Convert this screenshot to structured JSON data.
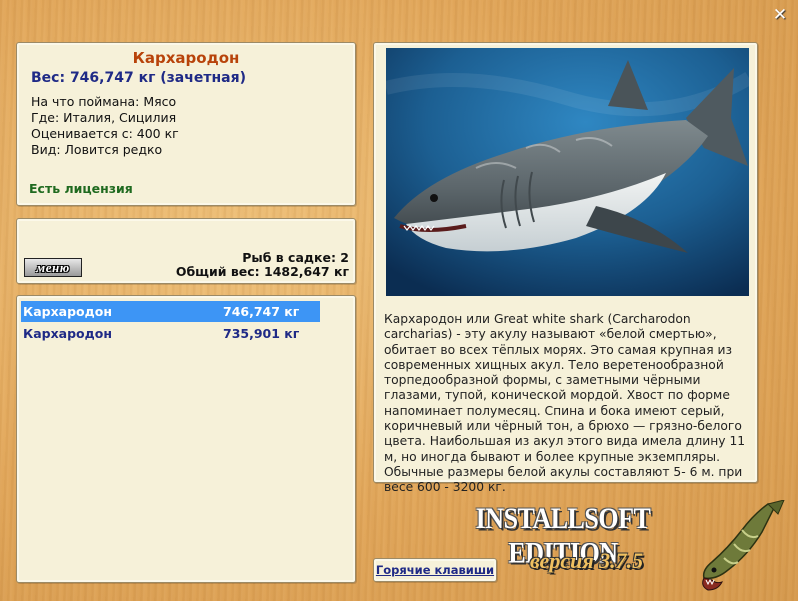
{
  "window": {
    "close_glyph": "✕"
  },
  "fish": {
    "name": "Кархародон",
    "weight_line": "Вес: 746,747 кг (зачетная)",
    "caught_on": "На что поймана: Мясо",
    "where": "Где: Италия, Сицилия",
    "rated_from": "Оценивается с: 400 кг",
    "kind": "Вид: Ловится редко",
    "license": "Есть лицензия"
  },
  "keep": {
    "menu_label": "меню",
    "count_line": "Рыб в садке: 2",
    "total_line": "Общий вес: 1482,647 кг"
  },
  "catch_list": [
    {
      "name": "Кархародон",
      "weight": "746,747 кг",
      "selected": true
    },
    {
      "name": "Кархародон",
      "weight": "735,901 кг",
      "selected": false
    }
  ],
  "description": "Кархародон или Great white shark (Carcharodon carcharias) - эту акулу называют «белой смертью», обитает во всех тёплых морях. Это самая крупная из современных хищных акул. Тело веретенообразной торпедообразной формы, с заметными чёрными глазами, тупой, конической мордой. Хвост по форме напоминает полумесяц. Спина и бока имеют серый, коричневый или чёрный тон, а брюхо — грязно-белого цвета. Наибольшая из акул этого вида имела длину 11 м, но иногда бывают и более крупные экземпляры. Обычные размеры белой акулы составляют 5- 6 м. при весе 600 - 3200 кг.",
  "hotkeys_label": "Горячие клавиши",
  "branding": {
    "edition": "INSTALLSOFT EDITION",
    "version": "версия 3.7.5"
  },
  "icons": [
    "close-icon",
    "shark-photo",
    "pike-logo-icon"
  ],
  "colors": {
    "title": "#b8430a",
    "weight": "#1f2a86",
    "license": "#1f6a1f",
    "selection": "#3d95f5",
    "panel": "#f6f1d9"
  }
}
